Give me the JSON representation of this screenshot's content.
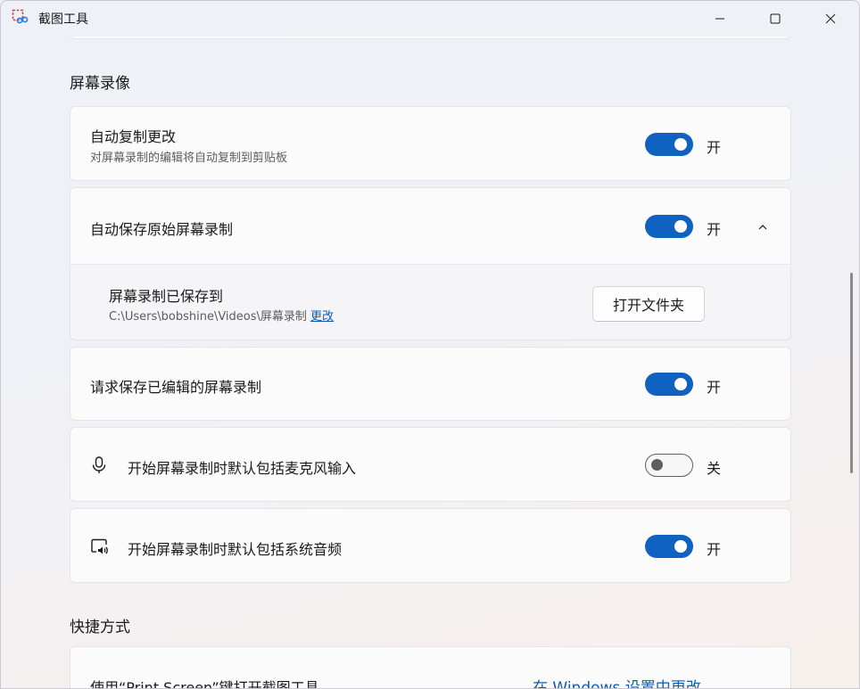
{
  "window": {
    "title": "截图工具",
    "icon": "snipping-tool-icon"
  },
  "sections": {
    "screen_recording_title": "屏幕录像",
    "shortcuts_title": "快捷方式"
  },
  "settings": {
    "auto_copy": {
      "label": "自动复制更改",
      "description": "对屏幕录制的编辑将自动复制到剪贴板",
      "state": "开",
      "on": true
    },
    "auto_save": {
      "label": "自动保存原始屏幕录制",
      "state": "开",
      "on": true,
      "saved_to_label": "屏幕录制已保存到",
      "saved_path": "C:\\Users\\bobshine\\Videos\\屏幕录制",
      "change_link": "更改",
      "open_folder_button": "打开文件夹"
    },
    "ask_save_edited": {
      "label": "请求保存已编辑的屏幕录制",
      "state": "开",
      "on": true
    },
    "include_mic": {
      "label": "开始屏幕录制时默认包括麦克风输入",
      "state": "关",
      "on": false,
      "icon": "microphone-icon"
    },
    "include_system_audio": {
      "label": "开始屏幕录制时默认包括系统音频",
      "state": "开",
      "on": true,
      "icon": "system-audio-icon"
    },
    "print_screen": {
      "label": "使用“Print Screen”键打开截图工具",
      "link": "在 Windows 设置中更改"
    }
  },
  "colors": {
    "accent": "#0f62c0",
    "link": "#0a5bb5"
  }
}
